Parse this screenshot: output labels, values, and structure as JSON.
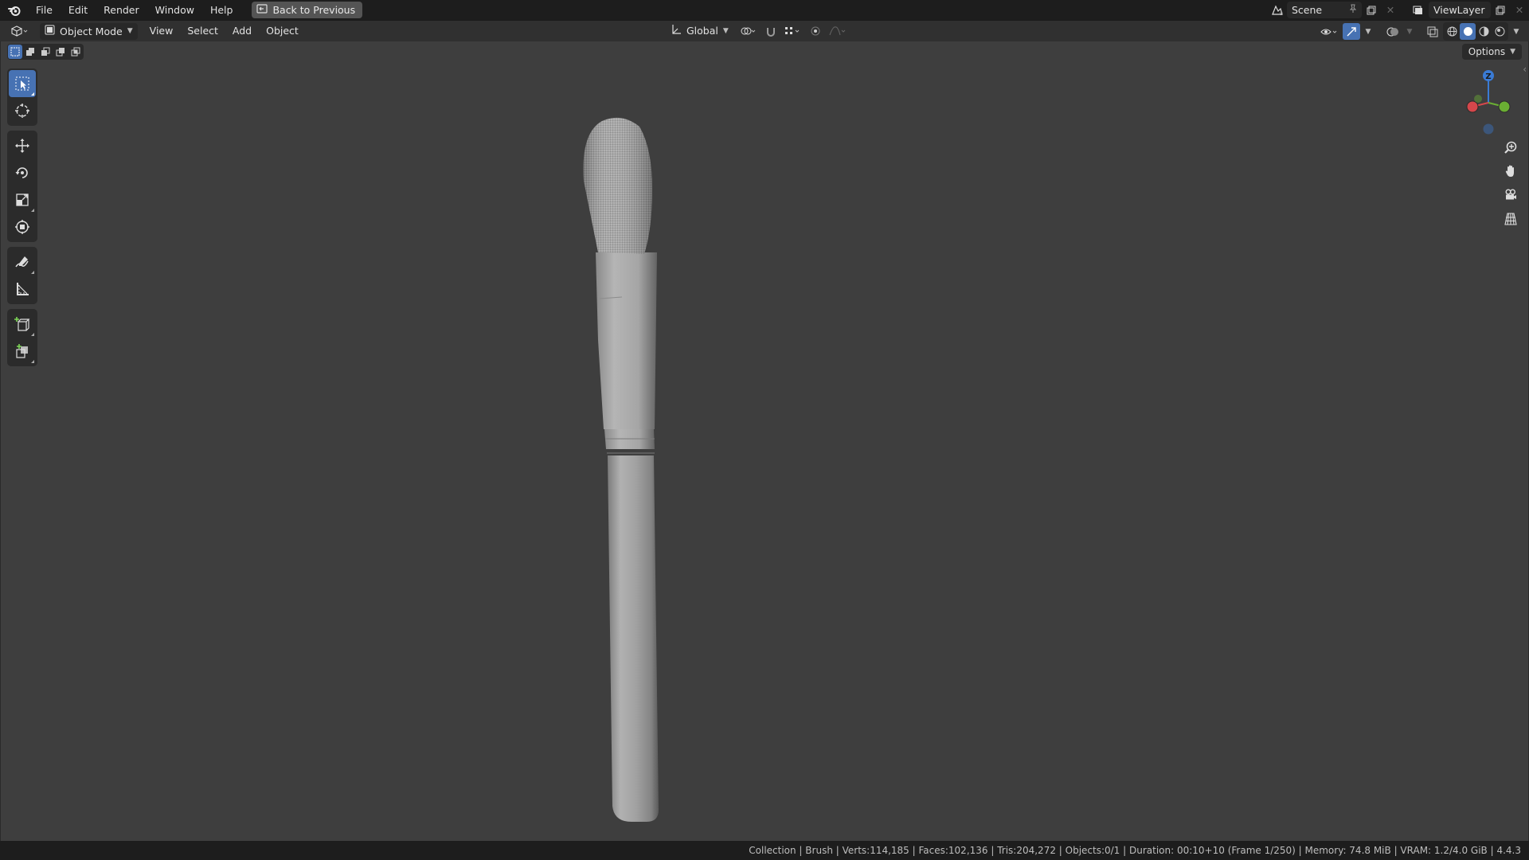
{
  "topbar": {
    "menus": [
      "File",
      "Edit",
      "Render",
      "Window",
      "Help"
    ],
    "back_label": "Back to Previous",
    "scene": "Scene",
    "view_layer": "ViewLayer"
  },
  "header": {
    "mode": "Object Mode",
    "menus": [
      "View",
      "Select",
      "Add",
      "Object"
    ],
    "orientation": "Global"
  },
  "viewport": {
    "options_label": "Options",
    "gizmo": {
      "z_label": "Z"
    }
  },
  "toolbar": {
    "tools": [
      "select-box",
      "cursor",
      "move",
      "rotate",
      "scale",
      "transform",
      "annotate",
      "measure",
      "add-cube",
      "add-object"
    ],
    "active_tool": "select-box"
  },
  "colors": {
    "accent": "#4772b3",
    "viewport_bg": "#3e3e3e",
    "axis_x": "#d5474b",
    "axis_y": "#6aae33",
    "axis_z": "#3a7bd5"
  },
  "statusbar": {
    "text": "Collection | Brush | Verts:114,185 | Faces:102,136 | Tris:204,272 | Objects:0/1 | Duration: 00:10+10 (Frame 1/250) | Memory: 74.8 MiB | VRAM: 1.2/4.0 GiB | 4.4.3"
  }
}
